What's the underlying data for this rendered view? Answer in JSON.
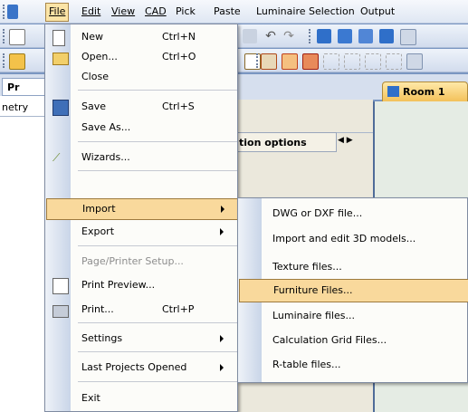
{
  "menubar": {
    "items": [
      "File",
      "Edit",
      "View",
      "CAD",
      "Pick",
      "Paste",
      "Luminaire Selection",
      "Output"
    ]
  },
  "panels": {
    "left_tab": "Pr",
    "left_label": "netry",
    "mid_tab": "tion options",
    "room_tab": "Room 1"
  },
  "file_menu": {
    "new": {
      "label": "New",
      "shortcut": "Ctrl+N"
    },
    "open": {
      "label": "Open...",
      "shortcut": "Ctrl+O"
    },
    "close": {
      "label": "Close"
    },
    "save": {
      "label": "Save",
      "shortcut": "Ctrl+S"
    },
    "save_as": {
      "label": "Save As..."
    },
    "wizards": {
      "label": "Wizards..."
    },
    "import": {
      "label": "Import"
    },
    "export": {
      "label": "Export"
    },
    "page_setup": {
      "label": "Page/Printer Setup..."
    },
    "print_preview": {
      "label": "Print Preview..."
    },
    "print": {
      "label": "Print...",
      "shortcut": "Ctrl+P"
    },
    "settings": {
      "label": "Settings"
    },
    "last_projects": {
      "label": "Last Projects Opened"
    },
    "exit": {
      "label": "Exit"
    }
  },
  "import_submenu": {
    "items": [
      "DWG or DXF file...",
      "Import and edit 3D models...",
      "Texture files...",
      "Furniture Files...",
      "Luminaire files...",
      "Calculation Grid Files...",
      "R-table files..."
    ],
    "highlighted": "Furniture Files..."
  },
  "colors": {
    "highlight": "#f9d99c",
    "highlight_border": "#9d7a3e"
  }
}
